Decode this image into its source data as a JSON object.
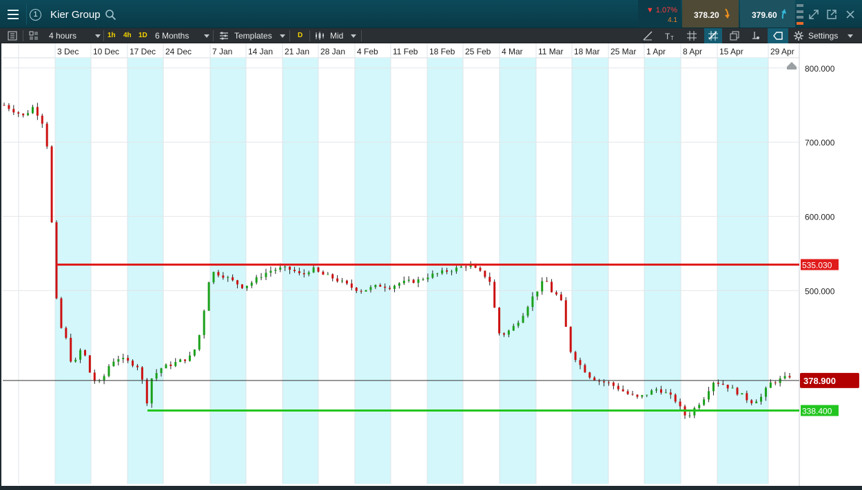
{
  "header": {
    "instrument": "Kier Group",
    "badge": "1",
    "change_pct": "▼ 1.07%",
    "change_pts": "4.1",
    "sell_price": "378.20",
    "buy_price": "379.60"
  },
  "toolbar": {
    "interval": "4 hours",
    "quick_1h": "1h",
    "quick_4h": "4h",
    "quick_1d": "1D",
    "range": "6 Months",
    "templates": "Templates",
    "d_badge": "D",
    "price_type": "Mid",
    "settings": "Settings"
  },
  "colors": {
    "up": "#1aa01a",
    "down": "#cc1111",
    "resistance": "#e01b1b",
    "support": "#22c51f",
    "current": "#b30000",
    "shade": "#d3f7fb"
  },
  "chart_data": {
    "type": "candlestick",
    "x_ticks": [
      "3 Dec",
      "10 Dec",
      "17 Dec",
      "24 Dec",
      "7 Jan",
      "14 Jan",
      "21 Jan",
      "28 Jan",
      "4 Feb",
      "11 Feb",
      "18 Feb",
      "25 Feb",
      "4 Mar",
      "11 Mar",
      "18 Mar",
      "25 Mar",
      "1 Apr",
      "8 Apr",
      "15 Apr",
      "29 Apr"
    ],
    "y_ticks": [
      "800.000",
      "700.000",
      "600.000",
      "500.000"
    ],
    "ylim": [
      283,
      810
    ],
    "grid": true,
    "horizontal_lines": [
      {
        "label": "535.030",
        "value": 535.03,
        "kind": "resistance"
      },
      {
        "label": "338.400",
        "value": 338.4,
        "kind": "support"
      }
    ],
    "current_price": {
      "label": "378.900",
      "value": 378.9
    },
    "price_path": [
      [
        0,
        750
      ],
      [
        4,
        735
      ],
      [
        6,
        748
      ],
      [
        8,
        725
      ],
      [
        9,
        688
      ],
      [
        10,
        560
      ],
      [
        11,
        460
      ],
      [
        13,
        430
      ],
      [
        14,
        395
      ],
      [
        16,
        425
      ],
      [
        18,
        380
      ],
      [
        20,
        375
      ],
      [
        21,
        395
      ],
      [
        23,
        410
      ],
      [
        25,
        405
      ],
      [
        27,
        400
      ],
      [
        28,
        395
      ],
      [
        29,
        340
      ],
      [
        30,
        380
      ],
      [
        32,
        395
      ],
      [
        34,
        400
      ],
      [
        36,
        405
      ],
      [
        38,
        410
      ],
      [
        39,
        420
      ],
      [
        40,
        440
      ],
      [
        41,
        475
      ],
      [
        42,
        515
      ],
      [
        43,
        525
      ],
      [
        45,
        520
      ],
      [
        47,
        512
      ],
      [
        49,
        505
      ],
      [
        51,
        512
      ],
      [
        53,
        522
      ],
      [
        55,
        528
      ],
      [
        57,
        530
      ],
      [
        59,
        528
      ],
      [
        61,
        520
      ],
      [
        63,
        530
      ],
      [
        65,
        522
      ],
      [
        67,
        518
      ],
      [
        69,
        512
      ],
      [
        71,
        505
      ],
      [
        73,
        500
      ],
      [
        75,
        503
      ],
      [
        77,
        507
      ],
      [
        79,
        505
      ],
      [
        81,
        510
      ],
      [
        83,
        512
      ],
      [
        85,
        514
      ],
      [
        87,
        520
      ],
      [
        89,
        523
      ],
      [
        91,
        527
      ],
      [
        93,
        530
      ],
      [
        95,
        535
      ],
      [
        97,
        527
      ],
      [
        99,
        518
      ],
      [
        100,
        508
      ],
      [
        101,
        445
      ],
      [
        102,
        440
      ],
      [
        104,
        448
      ],
      [
        106,
        465
      ],
      [
        108,
        488
      ],
      [
        110,
        508
      ],
      [
        111,
        515
      ],
      [
        112,
        500
      ],
      [
        114,
        490
      ],
      [
        115,
        455
      ],
      [
        116,
        420
      ],
      [
        118,
        400
      ],
      [
        120,
        385
      ],
      [
        122,
        378
      ],
      [
        124,
        375
      ],
      [
        126,
        368
      ],
      [
        128,
        360
      ],
      [
        130,
        355
      ],
      [
        132,
        362
      ],
      [
        134,
        368
      ],
      [
        136,
        360
      ],
      [
        138,
        350
      ],
      [
        139,
        335
      ],
      [
        140,
        330
      ],
      [
        142,
        345
      ],
      [
        144,
        360
      ],
      [
        145,
        378
      ],
      [
        147,
        375
      ],
      [
        149,
        368
      ],
      [
        151,
        360
      ],
      [
        153,
        350
      ],
      [
        155,
        355
      ],
      [
        156,
        365
      ],
      [
        157,
        375
      ],
      [
        159,
        380
      ],
      [
        160,
        382
      ],
      [
        161,
        385
      ]
    ]
  }
}
